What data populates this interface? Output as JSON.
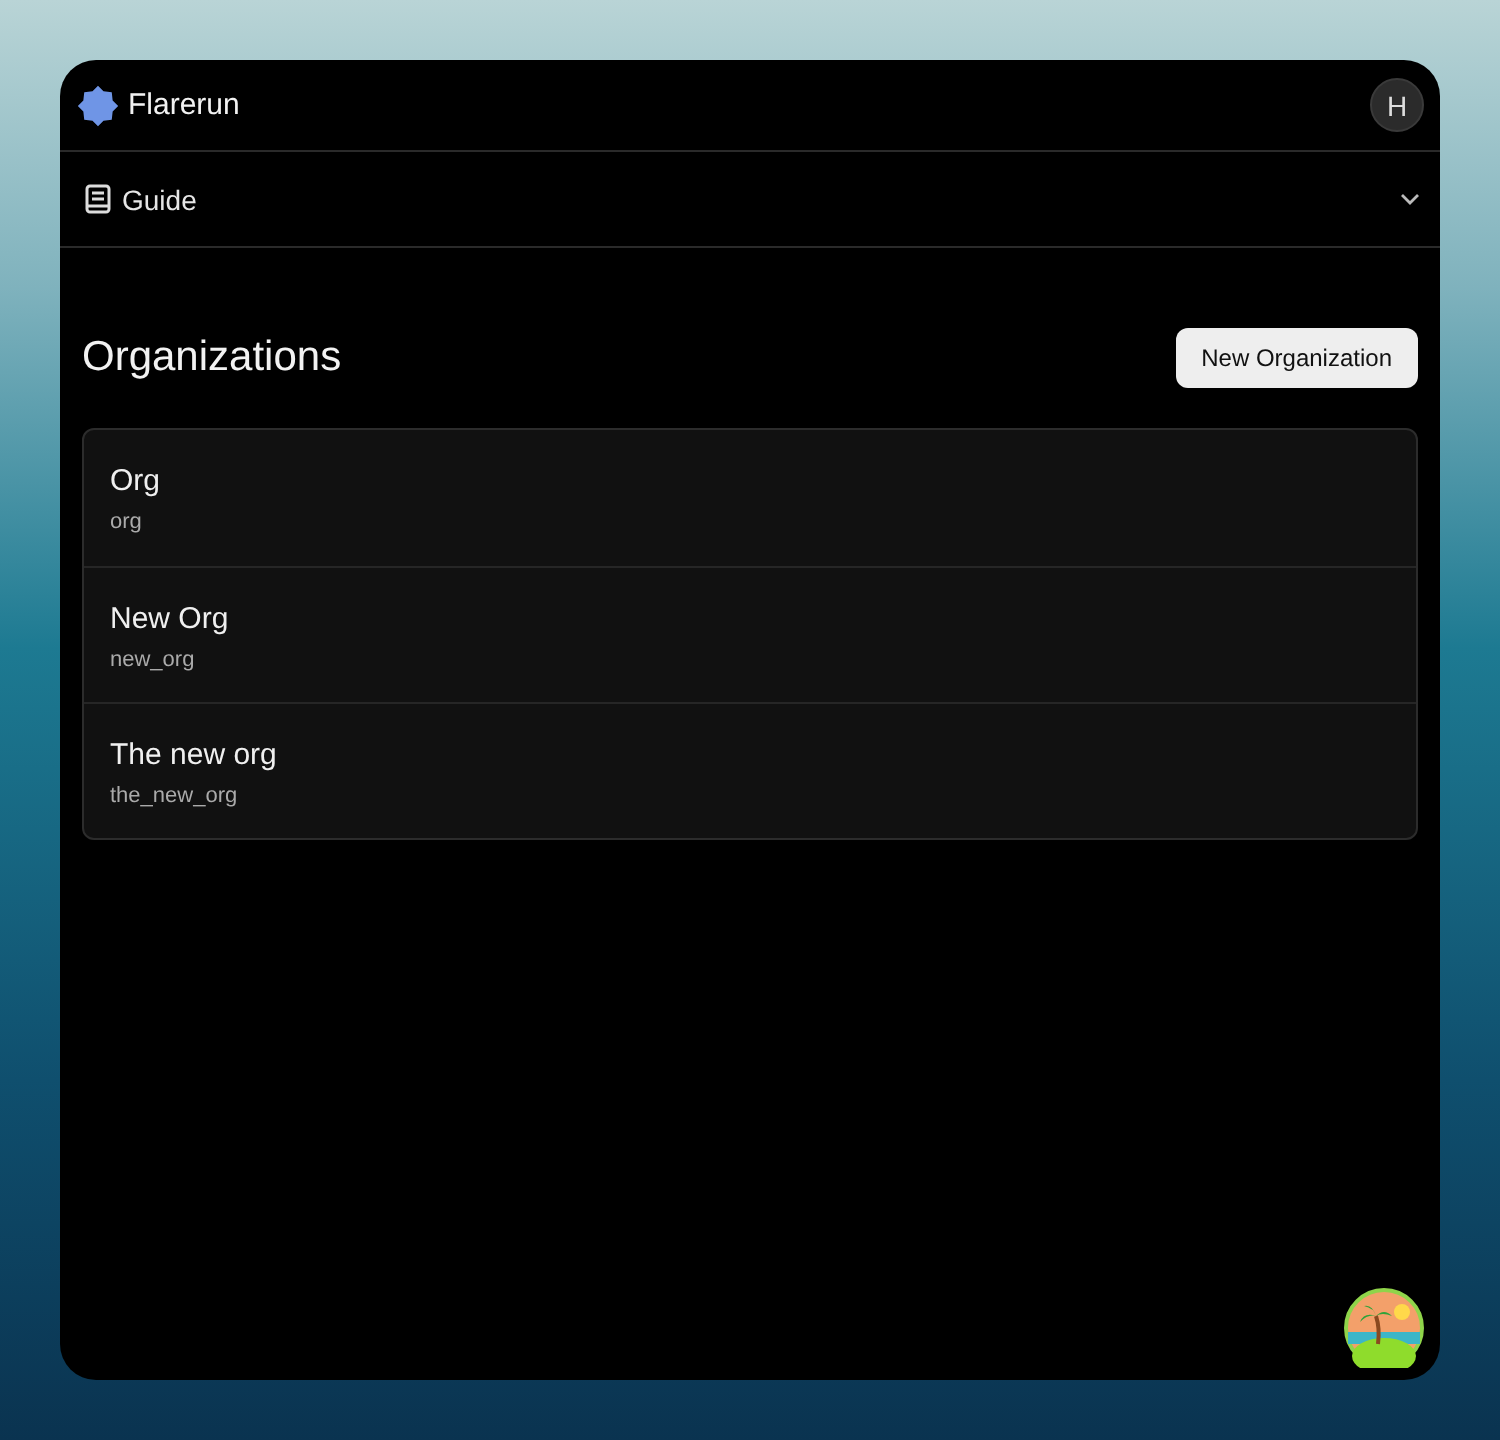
{
  "header": {
    "app_name": "Flarerun",
    "avatar_initial": "H"
  },
  "guide": {
    "label": "Guide",
    "expanded": false
  },
  "page": {
    "title": "Organizations",
    "new_button": "New Organization"
  },
  "organizations": [
    {
      "name": "Org",
      "slug": "org"
    },
    {
      "name": "New Org",
      "slug": "new_org"
    },
    {
      "name": "The new org",
      "slug": "the_new_org"
    }
  ]
}
